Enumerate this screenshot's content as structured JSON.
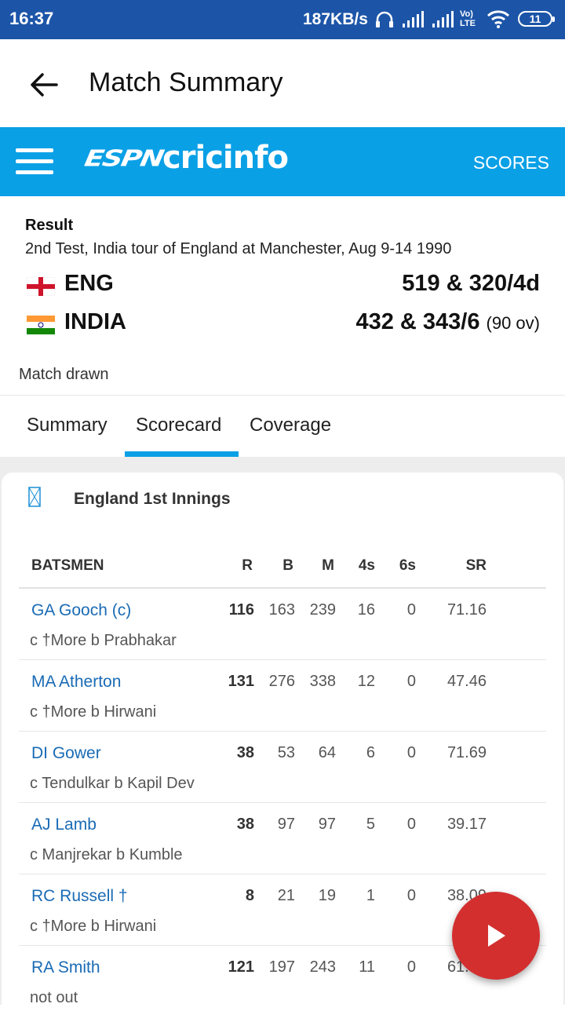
{
  "status_bar": {
    "time": "16:37",
    "speed": "187KB/s",
    "volte": "Vo) LTE",
    "battery": "11"
  },
  "appbar": {
    "title": "Match Summary"
  },
  "brand": {
    "espn": "ESPN",
    "cricinfo": "cricinfo",
    "scores_label": "SCORES",
    "color": "#0aa0e6"
  },
  "result": {
    "label": "Result",
    "description": "2nd Test, India tour of England at Manchester, Aug 9-14 1990",
    "teams": [
      {
        "name": "ENG",
        "score": "519 & 320/4d",
        "overs": ""
      },
      {
        "name": "INDIA",
        "score": "432 & 343/6",
        "overs": "(90 ov)"
      }
    ],
    "status": "Match drawn"
  },
  "tabs": [
    {
      "label": "Summary"
    },
    {
      "label": "Scorecard",
      "active": true
    },
    {
      "label": "Coverage"
    }
  ],
  "innings": {
    "title": "England 1st Innings",
    "headers": {
      "batsmen": "BATSMEN",
      "r": "R",
      "b": "B",
      "m": "M",
      "fours": "4s",
      "sixes": "6s",
      "sr": "SR"
    },
    "rows": [
      {
        "name": "GA Gooch (c)",
        "dismissal": "c †More b Prabhakar",
        "r": "116",
        "b": "163",
        "m": "239",
        "fours": "16",
        "sixes": "0",
        "sr": "71.16"
      },
      {
        "name": "MA Atherton",
        "dismissal": "c †More b Hirwani",
        "r": "131",
        "b": "276",
        "m": "338",
        "fours": "12",
        "sixes": "0",
        "sr": "47.46"
      },
      {
        "name": "DI Gower",
        "dismissal": "c Tendulkar b Kapil Dev",
        "r": "38",
        "b": "53",
        "m": "64",
        "fours": "6",
        "sixes": "0",
        "sr": "71.69"
      },
      {
        "name": "AJ Lamb",
        "dismissal": "c Manjrekar b Kumble",
        "r": "38",
        "b": "97",
        "m": "97",
        "fours": "5",
        "sixes": "0",
        "sr": "39.17"
      },
      {
        "name": "RC Russell †",
        "dismissal": "c †More b Hirwani",
        "r": "8",
        "b": "21",
        "m": "19",
        "fours": "1",
        "sixes": "0",
        "sr": "38.09"
      },
      {
        "name": "RA Smith",
        "dismissal": "not out",
        "r": "121",
        "b": "197",
        "m": "243",
        "fours": "11",
        "sixes": "0",
        "sr": "61.42"
      }
    ]
  },
  "fab": {
    "icon": "play-icon",
    "color": "#d32f2f"
  }
}
